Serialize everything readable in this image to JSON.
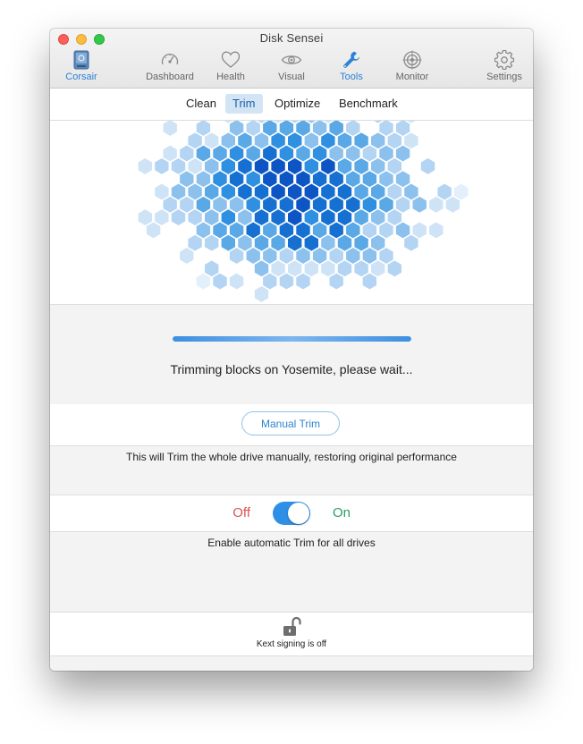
{
  "window": {
    "title": "Disk Sensei"
  },
  "toolbar": {
    "items": [
      {
        "label": "Corsair",
        "icon": "drive-icon",
        "active": true
      },
      {
        "label": "Dashboard",
        "icon": "speedometer-icon",
        "active": false
      },
      {
        "label": "Health",
        "icon": "heart-icon",
        "active": false
      },
      {
        "label": "Visual",
        "icon": "eye-icon",
        "active": false
      },
      {
        "label": "Tools",
        "icon": "wrench-icon",
        "active": true
      },
      {
        "label": "Monitor",
        "icon": "target-icon",
        "active": false
      },
      {
        "label": "Settings",
        "icon": "gear-icon",
        "active": false
      }
    ]
  },
  "segments": {
    "items": [
      "Clean",
      "Trim",
      "Optimize",
      "Benchmark"
    ],
    "selected": "Trim"
  },
  "progress": {
    "value": 1.0,
    "status": "Trimming blocks on Yosemite, please wait..."
  },
  "manual_trim": {
    "button_label": "Manual Trim",
    "description": "This will Trim the whole drive manually, restoring original performance"
  },
  "auto_trim": {
    "off_label": "Off",
    "on_label": "On",
    "state": "on",
    "description": "Enable automatic Trim for all drives"
  },
  "footer": {
    "icon": "unlocked-padlock-icon",
    "kext_text": "Kext signing is off"
  },
  "colors": {
    "accent": "#2f8fe6",
    "off": "#d9534f",
    "on": "#2e9a62"
  }
}
